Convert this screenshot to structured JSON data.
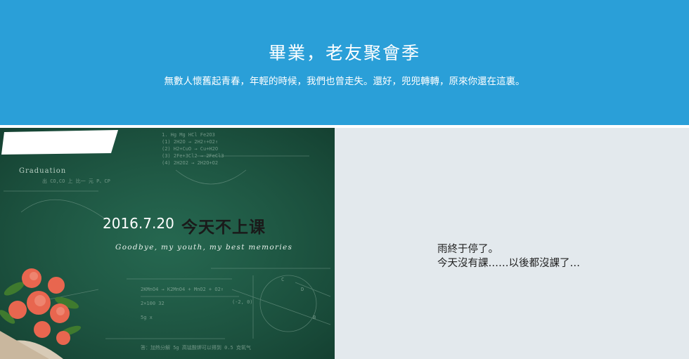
{
  "header": {
    "title": "畢業，老友聚會季",
    "subtitle": "無數人懷舊起青春，年輕的時候，我們也曾走失。還好，兜兜轉轉，原來你還在這裏。"
  },
  "board": {
    "date": "2016.7.20",
    "headline": "今天不上课",
    "english": "Goodbye, my youth, my best memories",
    "graduation": "Graduation"
  },
  "panel": {
    "line1": "雨終于停了。",
    "line2": "今天沒有課……以後都沒課了…"
  },
  "colors": {
    "header_bg": "#2a9fd8",
    "board_bg": "#1f5d48",
    "panel_bg": "#e3e9ed"
  }
}
